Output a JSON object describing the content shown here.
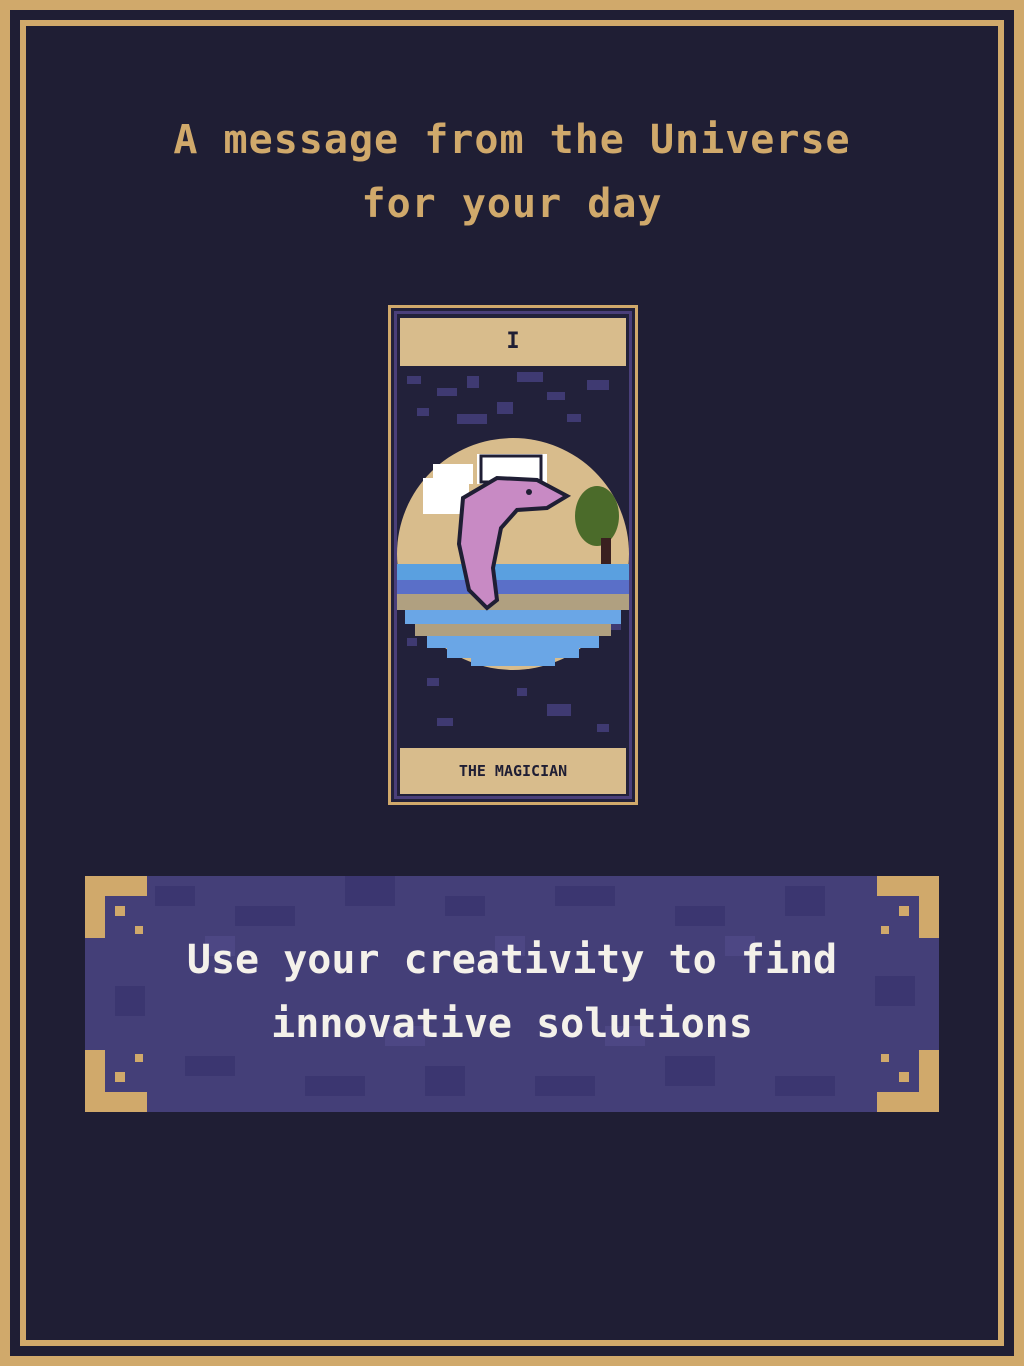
{
  "header": {
    "line1": "A message from the Universe",
    "line2": "for your day"
  },
  "card": {
    "numeral": "I",
    "name": "THE MAGICIAN",
    "art_icon": "leaping-dolphin-illustration"
  },
  "message": {
    "line1": "Use your creativity to find",
    "line2": "innovative solutions"
  },
  "colors": {
    "background": "#1f1e34",
    "gold": "#d0a96b",
    "card_label": "#d8bc8c",
    "message_panel": "#443f78",
    "message_text": "#f4f1ea"
  }
}
